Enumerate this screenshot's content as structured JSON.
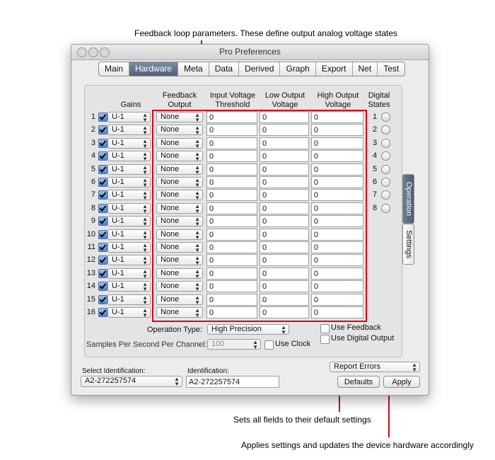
{
  "annotations": {
    "top": "Feedback loop parameters. These define output analog voltage states",
    "defaults": "Sets all fields to their default settings",
    "apply": "Applies settings and updates the device hardware accordingly"
  },
  "window": {
    "title": "Pro Preferences"
  },
  "tabs": [
    "Main",
    "Hardware",
    "Meta",
    "Data",
    "Derived",
    "Graph",
    "Export",
    "Net",
    "Test"
  ],
  "selected_tab": "Hardware",
  "headers": {
    "gains": "Gains",
    "feedback_output": "Feedback\nOutput",
    "input_voltage_threshold": "Input Voltage\nThreshold",
    "low_output_voltage": "Low Output\nVoltage",
    "high_output_voltage": "High Output\nVoltage",
    "digital_states": "Digital\nStates"
  },
  "rows": [
    {
      "n": "1",
      "gain": "U-1",
      "feedback": "None",
      "threshold": "0",
      "low": "0",
      "high": "0"
    },
    {
      "n": "2",
      "gain": "U-1",
      "feedback": "None",
      "threshold": "0",
      "low": "0",
      "high": "0"
    },
    {
      "n": "3",
      "gain": "U-1",
      "feedback": "None",
      "threshold": "0",
      "low": "0",
      "high": "0"
    },
    {
      "n": "4",
      "gain": "U-1",
      "feedback": "None",
      "threshold": "0",
      "low": "0",
      "high": "0"
    },
    {
      "n": "5",
      "gain": "U-1",
      "feedback": "None",
      "threshold": "0",
      "low": "0",
      "high": "0"
    },
    {
      "n": "6",
      "gain": "U-1",
      "feedback": "None",
      "threshold": "0",
      "low": "0",
      "high": "0"
    },
    {
      "n": "7",
      "gain": "U-1",
      "feedback": "None",
      "threshold": "0",
      "low": "0",
      "high": "0"
    },
    {
      "n": "8",
      "gain": "U-1",
      "feedback": "None",
      "threshold": "0",
      "low": "0",
      "high": "0"
    },
    {
      "n": "9",
      "gain": "U-1",
      "feedback": "None",
      "threshold": "0",
      "low": "0",
      "high": "0"
    },
    {
      "n": "10",
      "gain": "U-1",
      "feedback": "None",
      "threshold": "0",
      "low": "0",
      "high": "0"
    },
    {
      "n": "11",
      "gain": "U-1",
      "feedback": "None",
      "threshold": "0",
      "low": "0",
      "high": "0"
    },
    {
      "n": "12",
      "gain": "U-1",
      "feedback": "None",
      "threshold": "0",
      "low": "0",
      "high": "0"
    },
    {
      "n": "13",
      "gain": "U-1",
      "feedback": "None",
      "threshold": "0",
      "low": "0",
      "high": "0"
    },
    {
      "n": "14",
      "gain": "U-1",
      "feedback": "None",
      "threshold": "0",
      "low": "0",
      "high": "0"
    },
    {
      "n": "15",
      "gain": "U-1",
      "feedback": "None",
      "threshold": "0",
      "low": "0",
      "high": "0"
    },
    {
      "n": "16",
      "gain": "U-1",
      "feedback": "None",
      "threshold": "0",
      "low": "0",
      "high": "0"
    }
  ],
  "digital_states": [
    "1",
    "2",
    "3",
    "4",
    "5",
    "6",
    "7",
    "8"
  ],
  "operation_type": {
    "label": "Operation Type:",
    "value": "High Precision"
  },
  "samples": {
    "label": "Samples Per Second Per Channel:",
    "value": "100"
  },
  "checkboxes": {
    "use_feedback": "Use Feedback",
    "use_digital_output": "Use Digital Output",
    "use_clock": "Use Clock"
  },
  "side_tabs": {
    "operation": "Operation",
    "settings": "Settings"
  },
  "select_identification": {
    "label": "Select Identification:",
    "value": "A2-272257574"
  },
  "identification": {
    "label": "Identification:",
    "value": "A2-272257574"
  },
  "report_errors": "Report Errors",
  "buttons": {
    "defaults": "Defaults",
    "apply": "Apply"
  },
  "colors": {
    "annotation": "#e0001b",
    "selected_tab": "#5a6c84",
    "checkbox": "#4a82d0"
  }
}
